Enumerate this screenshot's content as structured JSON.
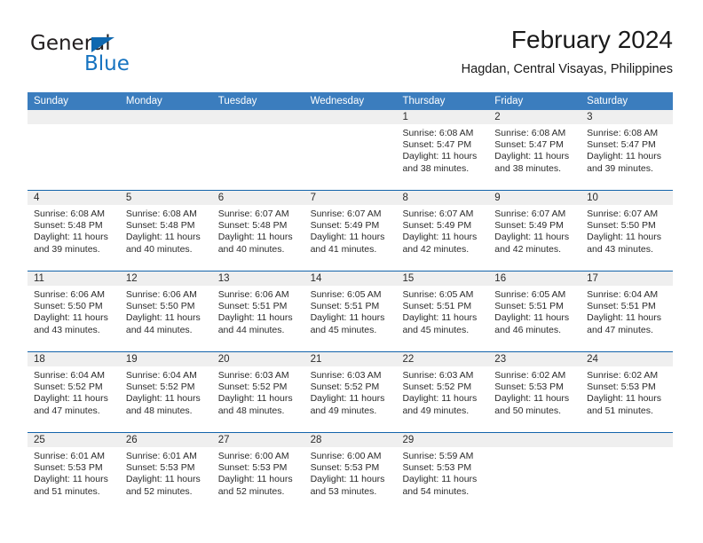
{
  "logo": {
    "word_one": "General",
    "word_two": "Blue",
    "triangle_color": "#0f68b0",
    "blue_text_color": "#1673c0"
  },
  "header": {
    "title": "February 2024",
    "location": "Hagdan, Central Visayas, Philippines"
  },
  "theme": {
    "header_blue": "#3b7dbe",
    "rule_blue": "#1464ab",
    "daynum_band": "#efefef"
  },
  "weekdays": [
    "Sunday",
    "Monday",
    "Tuesday",
    "Wednesday",
    "Thursday",
    "Friday",
    "Saturday"
  ],
  "weeks": [
    [
      {
        "day": "",
        "sunrise": "",
        "sunset": "",
        "daylight": ""
      },
      {
        "day": "",
        "sunrise": "",
        "sunset": "",
        "daylight": ""
      },
      {
        "day": "",
        "sunrise": "",
        "sunset": "",
        "daylight": ""
      },
      {
        "day": "",
        "sunrise": "",
        "sunset": "",
        "daylight": ""
      },
      {
        "day": "1",
        "sunrise": "Sunrise: 6:08 AM",
        "sunset": "Sunset: 5:47 PM",
        "daylight": "Daylight: 11 hours and 38 minutes."
      },
      {
        "day": "2",
        "sunrise": "Sunrise: 6:08 AM",
        "sunset": "Sunset: 5:47 PM",
        "daylight": "Daylight: 11 hours and 38 minutes."
      },
      {
        "day": "3",
        "sunrise": "Sunrise: 6:08 AM",
        "sunset": "Sunset: 5:47 PM",
        "daylight": "Daylight: 11 hours and 39 minutes."
      }
    ],
    [
      {
        "day": "4",
        "sunrise": "Sunrise: 6:08 AM",
        "sunset": "Sunset: 5:48 PM",
        "daylight": "Daylight: 11 hours and 39 minutes."
      },
      {
        "day": "5",
        "sunrise": "Sunrise: 6:08 AM",
        "sunset": "Sunset: 5:48 PM",
        "daylight": "Daylight: 11 hours and 40 minutes."
      },
      {
        "day": "6",
        "sunrise": "Sunrise: 6:07 AM",
        "sunset": "Sunset: 5:48 PM",
        "daylight": "Daylight: 11 hours and 40 minutes."
      },
      {
        "day": "7",
        "sunrise": "Sunrise: 6:07 AM",
        "sunset": "Sunset: 5:49 PM",
        "daylight": "Daylight: 11 hours and 41 minutes."
      },
      {
        "day": "8",
        "sunrise": "Sunrise: 6:07 AM",
        "sunset": "Sunset: 5:49 PM",
        "daylight": "Daylight: 11 hours and 42 minutes."
      },
      {
        "day": "9",
        "sunrise": "Sunrise: 6:07 AM",
        "sunset": "Sunset: 5:49 PM",
        "daylight": "Daylight: 11 hours and 42 minutes."
      },
      {
        "day": "10",
        "sunrise": "Sunrise: 6:07 AM",
        "sunset": "Sunset: 5:50 PM",
        "daylight": "Daylight: 11 hours and 43 minutes."
      }
    ],
    [
      {
        "day": "11",
        "sunrise": "Sunrise: 6:06 AM",
        "sunset": "Sunset: 5:50 PM",
        "daylight": "Daylight: 11 hours and 43 minutes."
      },
      {
        "day": "12",
        "sunrise": "Sunrise: 6:06 AM",
        "sunset": "Sunset: 5:50 PM",
        "daylight": "Daylight: 11 hours and 44 minutes."
      },
      {
        "day": "13",
        "sunrise": "Sunrise: 6:06 AM",
        "sunset": "Sunset: 5:51 PM",
        "daylight": "Daylight: 11 hours and 44 minutes."
      },
      {
        "day": "14",
        "sunrise": "Sunrise: 6:05 AM",
        "sunset": "Sunset: 5:51 PM",
        "daylight": "Daylight: 11 hours and 45 minutes."
      },
      {
        "day": "15",
        "sunrise": "Sunrise: 6:05 AM",
        "sunset": "Sunset: 5:51 PM",
        "daylight": "Daylight: 11 hours and 45 minutes."
      },
      {
        "day": "16",
        "sunrise": "Sunrise: 6:05 AM",
        "sunset": "Sunset: 5:51 PM",
        "daylight": "Daylight: 11 hours and 46 minutes."
      },
      {
        "day": "17",
        "sunrise": "Sunrise: 6:04 AM",
        "sunset": "Sunset: 5:51 PM",
        "daylight": "Daylight: 11 hours and 47 minutes."
      }
    ],
    [
      {
        "day": "18",
        "sunrise": "Sunrise: 6:04 AM",
        "sunset": "Sunset: 5:52 PM",
        "daylight": "Daylight: 11 hours and 47 minutes."
      },
      {
        "day": "19",
        "sunrise": "Sunrise: 6:04 AM",
        "sunset": "Sunset: 5:52 PM",
        "daylight": "Daylight: 11 hours and 48 minutes."
      },
      {
        "day": "20",
        "sunrise": "Sunrise: 6:03 AM",
        "sunset": "Sunset: 5:52 PM",
        "daylight": "Daylight: 11 hours and 48 minutes."
      },
      {
        "day": "21",
        "sunrise": "Sunrise: 6:03 AM",
        "sunset": "Sunset: 5:52 PM",
        "daylight": "Daylight: 11 hours and 49 minutes."
      },
      {
        "day": "22",
        "sunrise": "Sunrise: 6:03 AM",
        "sunset": "Sunset: 5:52 PM",
        "daylight": "Daylight: 11 hours and 49 minutes."
      },
      {
        "day": "23",
        "sunrise": "Sunrise: 6:02 AM",
        "sunset": "Sunset: 5:53 PM",
        "daylight": "Daylight: 11 hours and 50 minutes."
      },
      {
        "day": "24",
        "sunrise": "Sunrise: 6:02 AM",
        "sunset": "Sunset: 5:53 PM",
        "daylight": "Daylight: 11 hours and 51 minutes."
      }
    ],
    [
      {
        "day": "25",
        "sunrise": "Sunrise: 6:01 AM",
        "sunset": "Sunset: 5:53 PM",
        "daylight": "Daylight: 11 hours and 51 minutes."
      },
      {
        "day": "26",
        "sunrise": "Sunrise: 6:01 AM",
        "sunset": "Sunset: 5:53 PM",
        "daylight": "Daylight: 11 hours and 52 minutes."
      },
      {
        "day": "27",
        "sunrise": "Sunrise: 6:00 AM",
        "sunset": "Sunset: 5:53 PM",
        "daylight": "Daylight: 11 hours and 52 minutes."
      },
      {
        "day": "28",
        "sunrise": "Sunrise: 6:00 AM",
        "sunset": "Sunset: 5:53 PM",
        "daylight": "Daylight: 11 hours and 53 minutes."
      },
      {
        "day": "29",
        "sunrise": "Sunrise: 5:59 AM",
        "sunset": "Sunset: 5:53 PM",
        "daylight": "Daylight: 11 hours and 54 minutes."
      },
      {
        "day": "",
        "sunrise": "",
        "sunset": "",
        "daylight": ""
      },
      {
        "day": "",
        "sunrise": "",
        "sunset": "",
        "daylight": ""
      }
    ]
  ]
}
